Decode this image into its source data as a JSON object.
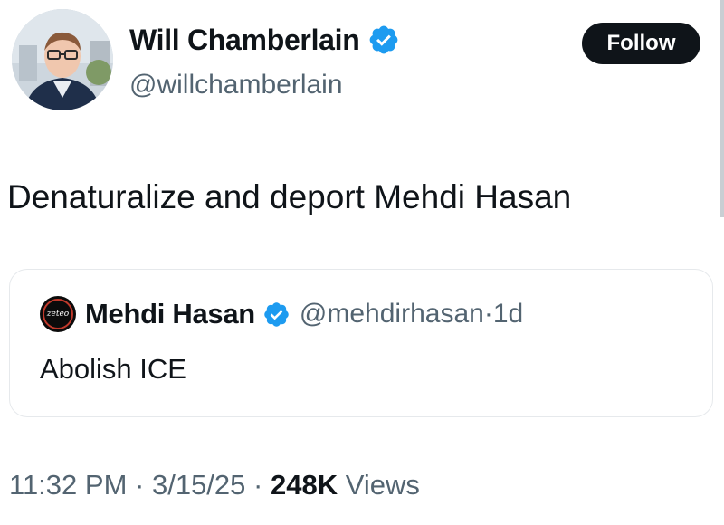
{
  "author": {
    "display_name": "Will Chamberlain",
    "handle": "@willchamberlain",
    "verified": true
  },
  "follow_label": "Follow",
  "tweet": {
    "text": "Denaturalize and deport Mehdi Hasan"
  },
  "quoted_tweet": {
    "avatar_text": "zeteo",
    "display_name": "Mehdi Hasan",
    "handle": "@mehdirhasan",
    "separator": "·",
    "age": "1d",
    "verified": true,
    "text": "Abolish ICE"
  },
  "meta": {
    "time": "11:32 PM",
    "date": "3/15/25",
    "separator": "·",
    "views_count": "248K",
    "views_label": "Views"
  },
  "colors": {
    "verified_blue": "#1d9bf0",
    "secondary_text": "#536471",
    "primary_text": "#0f1419"
  }
}
